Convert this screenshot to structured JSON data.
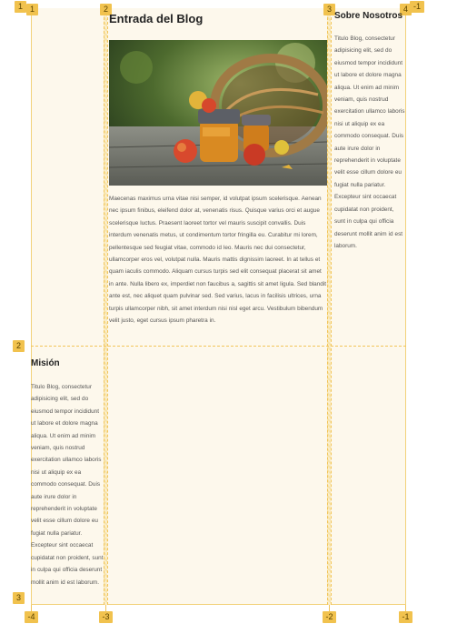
{
  "grid_labels": {
    "col_top": [
      "1",
      "2",
      "3",
      "4",
      "-1"
    ],
    "row_left": [
      "1",
      "2",
      "3"
    ],
    "col_bottom": [
      "-4",
      "-3",
      "-2",
      "-1"
    ]
  },
  "blog": {
    "title": "Entrada del Blog",
    "image_alt": "basket of apples and jam jars on a wooden table",
    "body": "Maecenas maximus urna vitae nisi semper, id volutpat ipsum scelerisque. Aenean nec ipsum finibus, eleifend dolor at, venenatis risus. Quisque varius orci et augue scelerisque luctus. Praesent laoreet tortor vel mauris suscipit convallis. Duis interdum venenatis metus, ut condimentum tortor fringilla eu. Curabitur mi lorem, pellentesque sed feugiat vitae, commodo id leo. Mauris nec dui consectetur, ullamcorper eros vel, volutpat nulla. Mauris mattis dignissim laoreet. In at tellus et quam iaculis commodo. Aliquam cursus turpis sed elit consequat placerat sit amet in ante. Nulla libero ex, imperdiet non faucibus a, sagittis sit amet ligula. Sed blandit ante est, nec aliquet quam pulvinar sed. Sed varius, lacus in facilisis ultrices, urna turpis ullamcorper nibh, sit amet interdum nisi nisl eget arcu. Vestibulum bibendum velit justo, eget cursus ipsum pharetra in."
  },
  "about": {
    "title": "Sobre Nosotros",
    "body": "Titulo Blog, consectetur adipisicing elit, sed do eiusmod tempor incididunt ut labore et dolore magna aliqua. Ut enim ad minim veniam, quis nostrud exercitation ullamco laboris nisi ut aliquip ex ea commodo consequat. Duis aute irure dolor in reprehenderit in voluptate velit esse cillum dolore eu fugiat nulla pariatur. Excepteur sint occaecat cupidatat non proident, sunt in culpa qui officia deserunt mollit anim id est laborum."
  },
  "mission": {
    "title": "Misión",
    "body": "Titulo Blog, consectetur adipisicing elit, sed do eiusmod tempor incididunt ut labore et dolore magna aliqua. Ut enim ad minim veniam, quis nostrud exercitation ullamco laboris nisi ut aliquip ex ea commodo consequat. Duis aute irure dolor in reprehenderit in voluptate velit esse cillum dolore eu fugiat nulla pariatur. Excepteur sint occaecat cupidatat non proident, sunt in culpa qui officia deserunt mollit anim id est laborum."
  },
  "colors": {
    "grid_line": "#f2c55a",
    "badge": "#f1c24e",
    "area_bg": "#fdf8ec"
  }
}
